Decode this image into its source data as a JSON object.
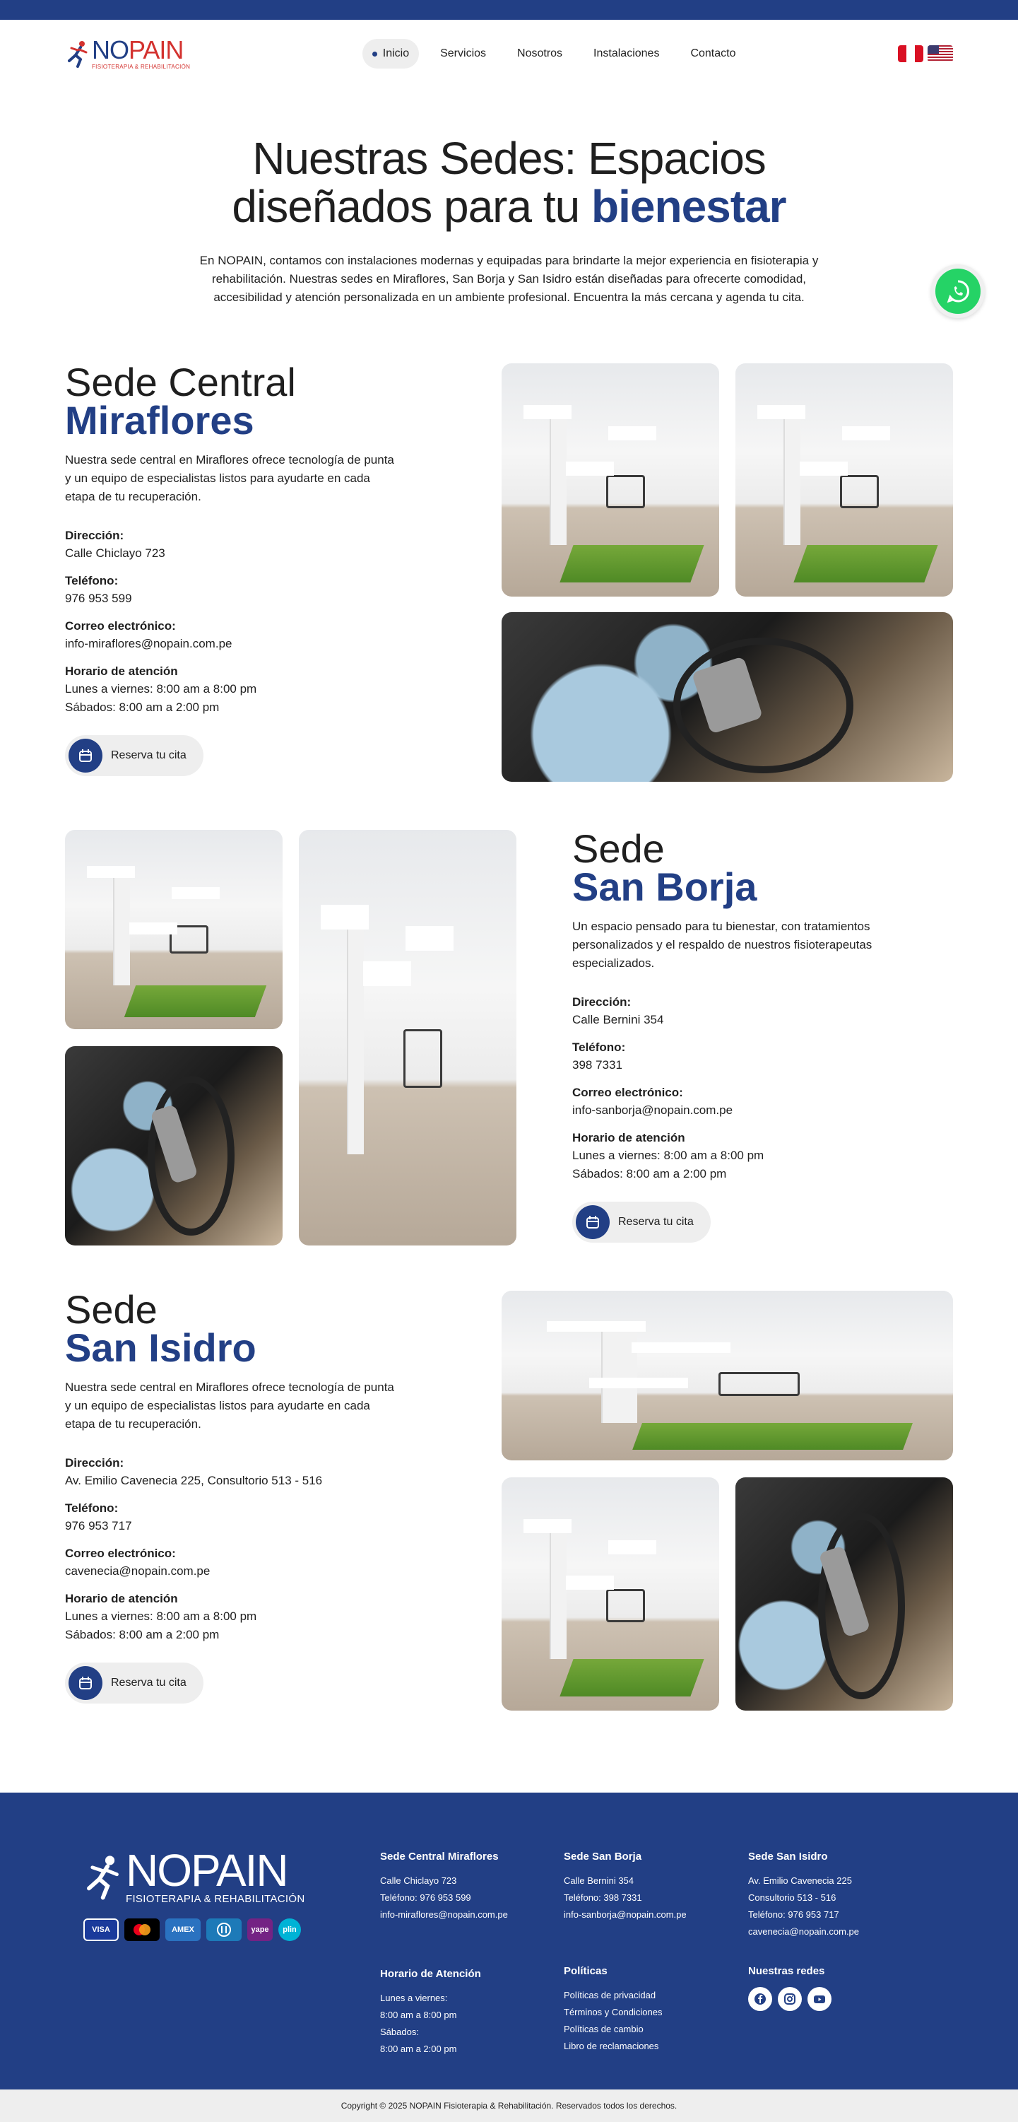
{
  "header": {
    "logo": {
      "brand_no": "NO",
      "brand_pain": "PAIN",
      "tagline": "FISIOTERAPIA & REHABILITACIÓN"
    },
    "nav": [
      {
        "label": "Inicio",
        "active": true
      },
      {
        "label": "Servicios",
        "active": false
      },
      {
        "label": "Nosotros",
        "active": false
      },
      {
        "label": "Instalaciones",
        "active": false
      },
      {
        "label": "Contacto",
        "active": false
      }
    ],
    "languages": [
      "flag-peru-icon",
      "flag-usa-icon"
    ]
  },
  "hero": {
    "title_line1": "Nuestras Sedes: Espacios",
    "title_line2_plain": "diseñados para tu ",
    "title_line2_accent": "bienestar",
    "description": "En NOPAIN, contamos con instalaciones modernas y equipadas para brindarte la mejor experiencia en fisioterapia y rehabilitación. Nuestras sedes en Miraflores, San Borja y San Isidro están diseñadas para ofrecerte comodidad, accesibilidad y atención personalizada en un ambiente profesional. Encuentra la más cercana y agenda tu cita."
  },
  "sedes": [
    {
      "title_plain": "Sede Central",
      "title_accent": "Miraflores",
      "description": "Nuestra sede central en Miraflores ofrece tecnología de punta y un equipo de especialistas listos para ayudarte en cada etapa de tu recuperación.",
      "direccion_label": "Dirección:",
      "direccion": "Calle Chiclayo 723",
      "telefono_label": "Teléfono:",
      "telefono": "976 953 599",
      "correo_label": "Correo electrónico:",
      "correo": "info-miraflores@nopain.com.pe",
      "horario_label": "Horario de atención",
      "horario_semana": "Lunes a viernes: 8:00 am a 8:00 pm",
      "horario_sabado": "Sábados: 8:00 am a 2:00 pm",
      "cta": "Reserva tu cita"
    },
    {
      "title_plain": "Sede",
      "title_accent": "San Borja",
      "description": "Un espacio pensado para tu bienestar, con tratamientos personalizados y el respaldo de nuestros fisioterapeutas especializados.",
      "direccion_label": "Dirección:",
      "direccion": "Calle Bernini 354",
      "telefono_label": "Teléfono:",
      "telefono": "398 7331",
      "correo_label": "Correo electrónico:",
      "correo": "info-sanborja@nopain.com.pe",
      "horario_label": "Horario de atención",
      "horario_semana": "Lunes a viernes: 8:00 am a 8:00 pm",
      "horario_sabado": "Sábados: 8:00 am a 2:00 pm",
      "cta": "Reserva tu cita"
    },
    {
      "title_plain": "Sede",
      "title_accent": "San Isidro",
      "description": "Nuestra sede central en Miraflores ofrece tecnología de punta y un equipo de especialistas listos para ayudarte en cada etapa de tu recuperación.",
      "direccion_label": "Dirección:",
      "direccion": "Av. Emilio Cavenecia 225, Consultorio 513 - 516",
      "telefono_label": "Teléfono:",
      "telefono": "976 953 717",
      "correo_label": "Correo electrónico:",
      "correo": "cavenecia@nopain.com.pe",
      "horario_label": "Horario de atención",
      "horario_semana": "Lunes a viernes: 8:00 am a 8:00 pm",
      "horario_sabado": "Sábados: 8:00 am a 2:00 pm",
      "cta": "Reserva tu cita"
    }
  ],
  "footer": {
    "logo": {
      "brand": "NOPAIN",
      "tagline": "FISIOTERAPIA & REHABILITACIÓN"
    },
    "payments": [
      "VISA",
      "",
      "AMEX",
      "",
      "yape",
      "plin"
    ],
    "col_miraflores": {
      "title": "Sede Central Miraflores",
      "lines": [
        "Calle Chiclayo 723",
        "Teléfono: 976 953 599",
        "info-miraflores@nopain.com.pe"
      ]
    },
    "col_sanborja": {
      "title": "Sede San Borja",
      "lines": [
        "Calle Bernini 354",
        "Teléfono: 398 7331",
        "info-sanborja@nopain.com.pe"
      ]
    },
    "col_sanisidro": {
      "title": "Sede San Isidro",
      "lines": [
        "Av. Emilio Cavenecia 225",
        "Consultorio 513 - 516",
        "Teléfono: 976 953 717",
        "cavenecia@nopain.com.pe"
      ]
    },
    "col_horario": {
      "title": "Horario de Atención",
      "lines": [
        "Lunes a viernes:",
        "8:00 am a 8:00 pm",
        "Sábados:",
        "8:00 am a 2:00 pm"
      ]
    },
    "col_politicas": {
      "title": "Políticas",
      "lines": [
        "Políticas de privacidad",
        "Términos y Condiciones",
        "Políticas de cambio",
        "Libro de reclamaciones"
      ]
    },
    "col_redes": {
      "title": "Nuestras redes",
      "icons": [
        "facebook-icon",
        "instagram-icon",
        "youtube-icon"
      ]
    },
    "copyright": "Copyright © 2025 NOPAIN Fisioterapia & Rehabilitación. Reservados todos los derechos."
  },
  "colors": {
    "primary": "#223f85",
    "accent_red": "#d3322f",
    "whatsapp": "#25d366"
  }
}
